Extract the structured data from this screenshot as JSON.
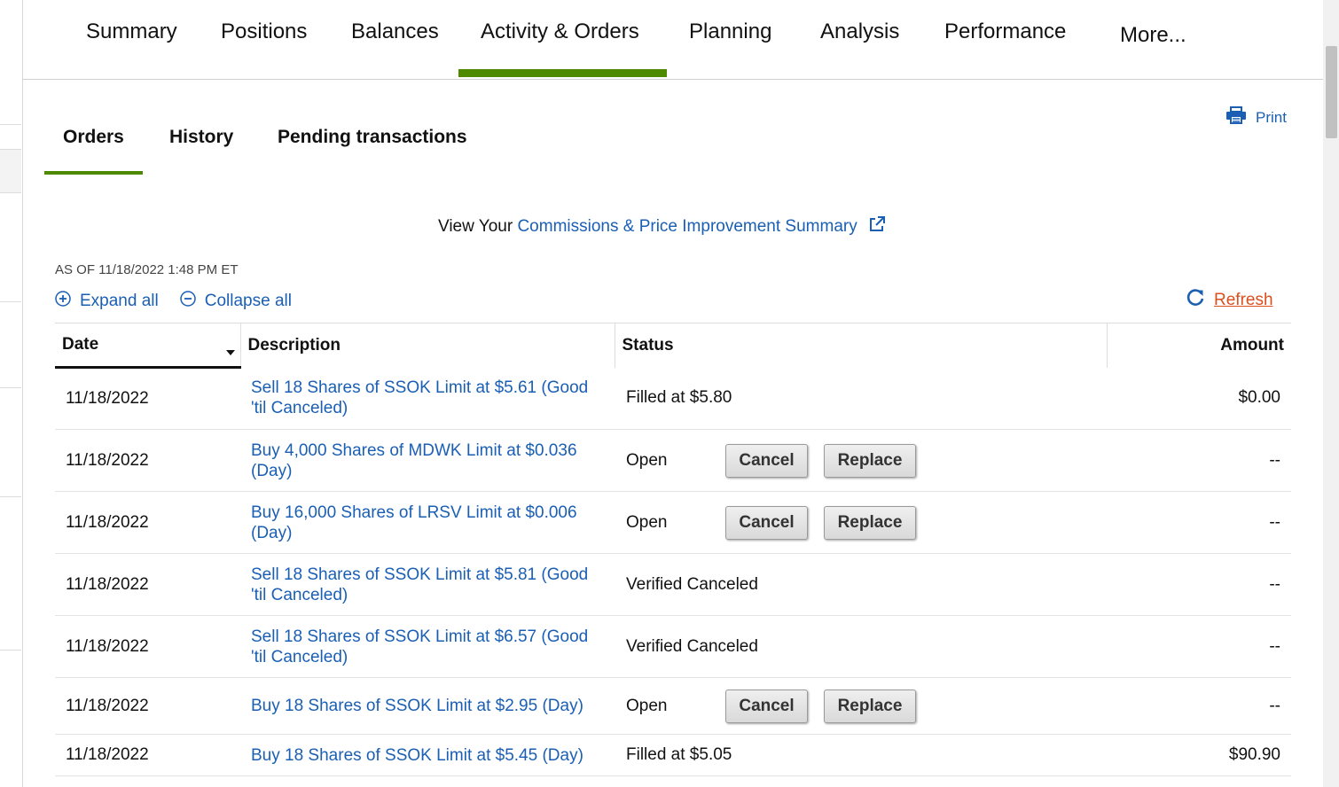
{
  "top_nav": {
    "tabs": [
      "Summary",
      "Positions",
      "Balances",
      "Activity & Orders",
      "Planning",
      "Analysis",
      "Performance",
      "More..."
    ],
    "active": "Activity & Orders"
  },
  "sub_tabs": {
    "tabs": [
      "Orders",
      "History",
      "Pending transactions"
    ],
    "active": "Orders"
  },
  "print_label": "Print",
  "summary_line": {
    "prefix": "View Your",
    "link": "Commissions & Price Improvement Summary"
  },
  "as_of": "AS OF 11/18/2022 1:48 PM ET",
  "expand_all": "Expand all",
  "collapse_all": "Collapse all",
  "refresh_label": "Refresh",
  "table": {
    "headers": {
      "date": "Date",
      "description": "Description",
      "status": "Status",
      "amount": "Amount"
    },
    "cancel_label": "Cancel",
    "replace_label": "Replace",
    "rows": [
      {
        "date": "11/18/2022",
        "description": "Sell 18 Shares of SSOK Limit at $5.61 (Good 'til Canceled)",
        "status": "Filled at $5.80",
        "amount": "$0.00"
      },
      {
        "date": "11/18/2022",
        "description": "Buy 4,000 Shares of MDWK Limit at $0.036 (Day)",
        "status": "Open",
        "amount": "--"
      },
      {
        "date": "11/18/2022",
        "description": "Buy 16,000 Shares of LRSV Limit at $0.006 (Day)",
        "status": "Open",
        "amount": "--"
      },
      {
        "date": "11/18/2022",
        "description": "Sell 18 Shares of SSOK Limit at $5.81 (Good 'til Canceled)",
        "status": "Verified Canceled",
        "amount": "--"
      },
      {
        "date": "11/18/2022",
        "description": "Sell 18 Shares of SSOK Limit at $6.57 (Good 'til Canceled)",
        "status": "Verified Canceled",
        "amount": "--"
      },
      {
        "date": "11/18/2022",
        "description": "Buy 18 Shares of SSOK Limit at $2.95 (Day)",
        "status": "Open",
        "amount": "--"
      },
      {
        "date": "11/18/2022",
        "description": "Buy 18 Shares of SSOK Limit at $5.45 (Day)",
        "status": "Filled at $5.05",
        "amount": "$90.90"
      }
    ]
  },
  "colors": {
    "accent_green": "#4d8a00",
    "link_blue": "#1a5fb4",
    "refresh_orange": "#d9501e"
  },
  "icons": [
    "printer-icon",
    "external-link-icon",
    "plus-circle-icon",
    "minus-circle-icon",
    "refresh-icon",
    "sort-down-icon"
  ]
}
